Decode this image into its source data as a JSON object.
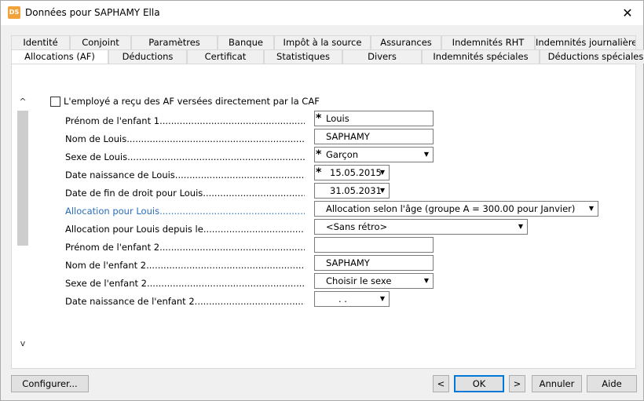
{
  "window": {
    "title": "Données pour SAPHAMY Ella",
    "app_icon_text": "DS",
    "close_glyph": "✕"
  },
  "tabs": {
    "row1": [
      "Identité",
      "Conjoint",
      "Paramètres",
      "Banque",
      "Impôt à la source",
      "Assurances",
      "Indemnités RHT",
      "Indemnités journalières"
    ],
    "row2": [
      "Allocations (AF)",
      "Déductions",
      "Certificat",
      "Statistiques",
      "Divers",
      "Indemnités spéciales",
      "Déductions spéciales"
    ],
    "active": "Allocations (AF)"
  },
  "scroll": {
    "up_glyph": "^",
    "down_glyph": "v"
  },
  "checkbox": {
    "label": "L'employé a reçu des AF versées directement par la CAF",
    "checked": false
  },
  "fields": [
    {
      "label": "Prénom de l'enfant 1",
      "value": "Louis",
      "required": true,
      "dropdown": false
    },
    {
      "label": "Nom de Louis",
      "value": "SAPHAMY",
      "required": false,
      "dropdown": false
    },
    {
      "label": "Sexe de Louis",
      "value": "Garçon",
      "required": true,
      "dropdown": true
    },
    {
      "label": "Date naissance de Louis",
      "value": "15.05.2015",
      "required": true,
      "dropdown": true
    },
    {
      "label": "Date de fin de droit pour Louis",
      "value": "31.05.2031",
      "required": false,
      "dropdown": true
    },
    {
      "label": "Allocation pour Louis",
      "value": "Allocation selon l'âge (groupe A = 300.00 pour Janvier)",
      "required": false,
      "dropdown": true,
      "link": true
    },
    {
      "label": "Allocation pour Louis depuis le",
      "value": "<Sans rétro>",
      "required": false,
      "dropdown": true
    },
    {
      "label": "Prénom de l'enfant 2",
      "value": "",
      "required": false,
      "dropdown": false
    },
    {
      "label": "Nom de l'enfant 2",
      "value": "SAPHAMY",
      "required": false,
      "dropdown": false
    },
    {
      "label": "Sexe de l'enfant 2",
      "value": "Choisir le sexe",
      "required": false,
      "dropdown": true
    },
    {
      "label": "Date naissance de l'enfant 2",
      "value": ". .",
      "required": false,
      "dropdown": true
    }
  ],
  "buttons": {
    "configure": "Configurer...",
    "prev": "<",
    "ok": "OK",
    "next": ">",
    "cancel": "Annuler",
    "help": "Aide"
  },
  "glyphs": {
    "required": "*",
    "dropdown": "▼"
  }
}
